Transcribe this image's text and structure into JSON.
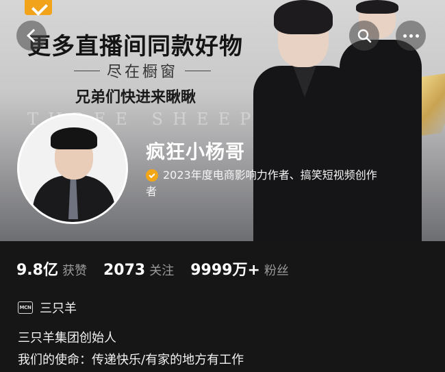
{
  "banner": {
    "headline": "更多直播间同款好物",
    "subline": "尽在橱窗",
    "tagline": "兄弟们快进来瞅瞅",
    "bg_text": "THREE SHEEP"
  },
  "icons": {
    "back": "back-arrow-icon",
    "search": "search-icon",
    "more": "more-dots-icon",
    "verified": "verified-check-icon",
    "brand": "brand-chevron-icon",
    "mcn": "mcn-badge-icon"
  },
  "profile": {
    "username": "疯狂小杨哥",
    "certification_line1": "2023年度电商影响力作者、搞笑短视频创作",
    "certification_line2": "者"
  },
  "stats": [
    {
      "value": "9.8亿",
      "label": "获赞"
    },
    {
      "value": "2073",
      "label": "关注"
    },
    {
      "value": "9999万+",
      "label": "粉丝"
    }
  ],
  "mcn": {
    "badge": "MCN",
    "name": "三只羊"
  },
  "bio": {
    "line1": "三只羊集团创始人",
    "line2": "我们的使命：传递快乐/有家的地方有工作"
  },
  "colors": {
    "verified": "#f3a616",
    "brand": "#f1a31c",
    "panel_bg": "#161616"
  }
}
